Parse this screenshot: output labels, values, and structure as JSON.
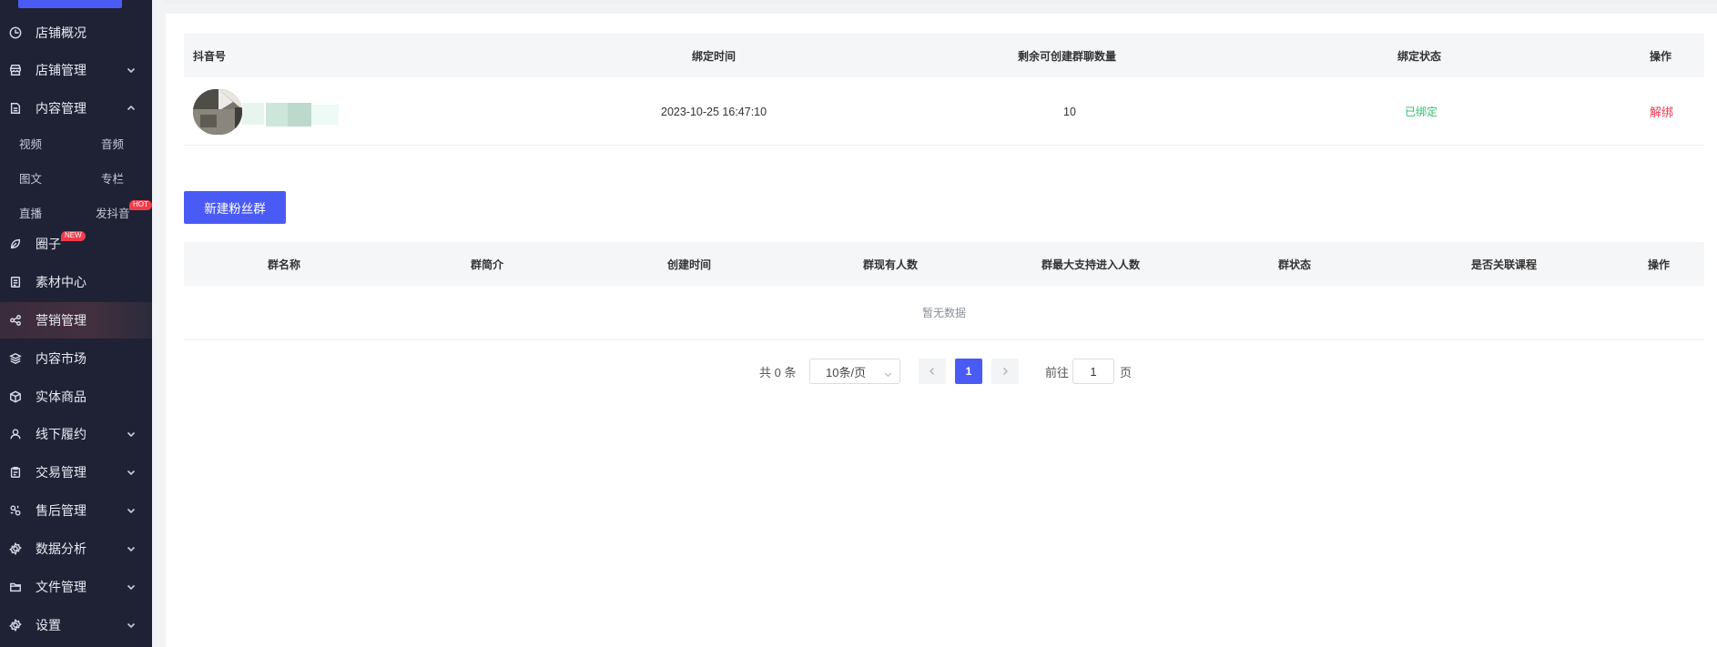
{
  "sidebar": {
    "items": [
      {
        "label": "店铺概况",
        "icon": "clock-icon"
      },
      {
        "label": "店铺管理",
        "icon": "store-icon",
        "expandable": true
      },
      {
        "label": "内容管理",
        "icon": "document-icon",
        "expanded": true
      },
      {
        "label": "圈子",
        "icon": "leaf-icon",
        "badge": "NEW"
      },
      {
        "label": "素材中心",
        "icon": "file-list-icon"
      },
      {
        "label": "营销管理",
        "icon": "share-icon",
        "active": true
      },
      {
        "label": "内容市场",
        "icon": "layers-icon"
      },
      {
        "label": "实体商品",
        "icon": "box-icon"
      },
      {
        "label": "线下履约",
        "icon": "user-icon",
        "expandable": true
      },
      {
        "label": "交易管理",
        "icon": "clipboard-icon",
        "expandable": true
      },
      {
        "label": "售后管理",
        "icon": "service-icon",
        "expandable": true
      },
      {
        "label": "数据分析",
        "icon": "gear-icon",
        "expandable": true
      },
      {
        "label": "文件管理",
        "icon": "folder-icon",
        "expandable": true
      },
      {
        "label": "设置",
        "icon": "settings-icon",
        "expandable": true
      }
    ],
    "content_sub": {
      "video": "视频",
      "audio": "音频",
      "article": "图文",
      "column": "专栏",
      "live": "直播",
      "douyin": "发抖音",
      "douyin_badge": "HOT"
    }
  },
  "bind_table": {
    "headers": {
      "account": "抖音号",
      "bind_time": "绑定时间",
      "remaining": "剩余可创建群聊数量",
      "status": "绑定状态",
      "action": "操作"
    },
    "rows": [
      {
        "bind_time": "2023-10-25 16:47:10",
        "remaining": "10",
        "status": "已绑定",
        "action": "解绑"
      }
    ]
  },
  "new_group_button": "新建粉丝群",
  "group_table": {
    "headers": [
      "群名称",
      "群简介",
      "创建时间",
      "群现有人数",
      "群最大支持进入人数",
      "群状态",
      "是否关联课程",
      "操作"
    ],
    "empty_text": "暂无数据"
  },
  "pagination": {
    "total": "共 0 条",
    "page_size": "10条/页",
    "current_page": "1",
    "goto_prefix": "前往",
    "goto_value": "1",
    "goto_suffix": "页"
  },
  "colors": {
    "sidebar_bg": "#1f2235",
    "primary": "#4a5bf5",
    "success": "#2dc26b",
    "danger": "#f5354f"
  }
}
